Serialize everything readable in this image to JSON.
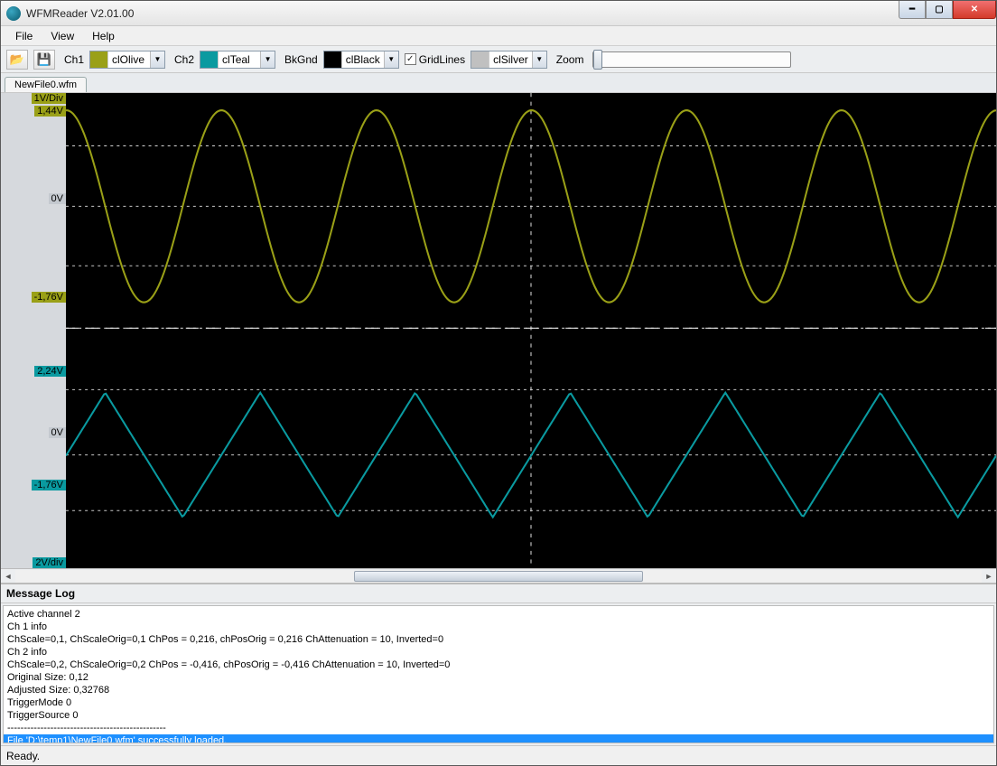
{
  "window": {
    "title": "WFMReader V2.01.00"
  },
  "menu": {
    "items": [
      "File",
      "View",
      "Help"
    ]
  },
  "toolbar": {
    "open_icon": "open-folder-icon",
    "save_icon": "save-disk-icon",
    "ch1_label": "Ch1",
    "ch1_color_name": "clOlive",
    "ch1_color": "#9aa017",
    "ch2_label": "Ch2",
    "ch2_color_name": "clTeal",
    "ch2_color": "#0a9aa0",
    "bkgnd_label": "BkGnd",
    "bkgnd_color_name": "clBlack",
    "bkgnd_color": "#000000",
    "gridlines_label": "GridLines",
    "gridlines_checked": true,
    "grid_color_name": "clSilver",
    "grid_color": "#c0c0c0",
    "zoom_label": "Zoom"
  },
  "tab": {
    "filename": "NewFile0.wfm"
  },
  "scope": {
    "ch1": {
      "scale_label": "1V/Div",
      "max_label": "1,44V",
      "zero_label": "0V",
      "min_label": "-1,76V"
    },
    "ch2": {
      "max_label": "2,24V",
      "zero_label": "0V",
      "min_label": "-1,76V",
      "scale_label": "2V/div"
    }
  },
  "chart_data": {
    "type": "line",
    "series": [
      {
        "name": "Ch1",
        "color": "#9aa017",
        "wave": "sine",
        "amplitude_v": 1.6,
        "offset_v": -0.16,
        "periods_visible": 6,
        "scale_v_per_div": 1,
        "labels": {
          "max": "1,44V",
          "zero": "0V",
          "min": "-1,76V"
        }
      },
      {
        "name": "Ch2",
        "color": "#0a9aa0",
        "wave": "triangle",
        "amplitude_v": 2.0,
        "offset_v": 0.24,
        "periods_visible": 6,
        "scale_v_per_div": 2,
        "labels": {
          "max": "2,24V",
          "zero": "0V",
          "min": "-1,76V"
        }
      }
    ],
    "gridlines": true,
    "background": "#000000",
    "grid_color": "#c0c0c0"
  },
  "log": {
    "header": "Message Log",
    "lines": [
      "Active channel 2",
      "Ch 1 info",
      "ChScale=0,1, ChScaleOrig=0,1 ChPos = 0,216, chPosOrig = 0,216 ChAttenuation = 10, Inverted=0",
      "Ch 2 info",
      "ChScale=0,2, ChScaleOrig=0,2 ChPos = -0,416, chPosOrig = -0,416 ChAttenuation = 10, Inverted=0",
      "Original Size: 0,12",
      "Adjusted Size: 0,32768",
      "TriggerMode 0",
      "TriggerSource 0",
      "------------------------------------------------"
    ],
    "selected_line": "File 'D:\\temp1\\NewFile0.wfm' successfully loaded."
  },
  "status": {
    "text": "Ready."
  }
}
